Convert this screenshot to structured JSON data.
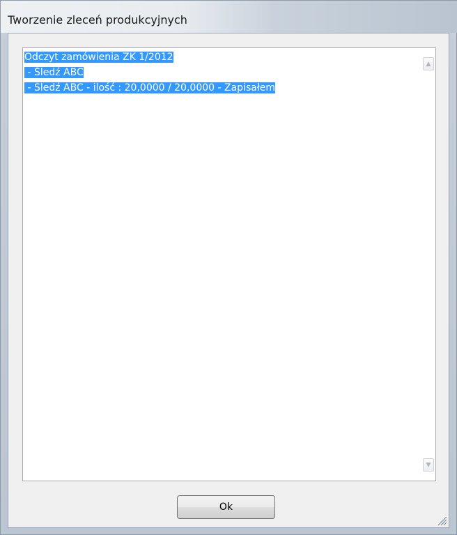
{
  "window": {
    "title": "Tworzenie zleceń produkcyjnych"
  },
  "log": {
    "lines": [
      "Odczyt zamówienia ZK 1/2012",
      " - Śledź ABC",
      " - Śledź ABC - ilość : 20,0000 / 20,0000 - Zapisałem"
    ],
    "selection_color": "#3399ff"
  },
  "buttons": {
    "ok_label": "Ok"
  }
}
